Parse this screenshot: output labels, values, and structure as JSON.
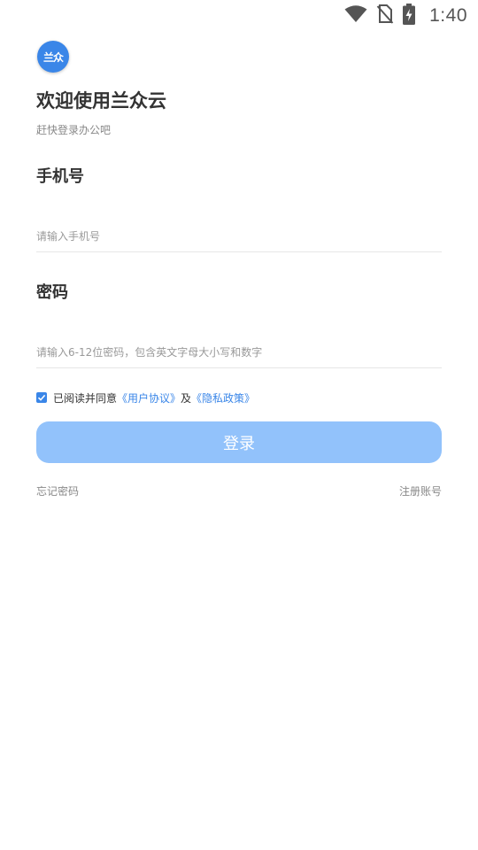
{
  "status_bar": {
    "time": "1:40",
    "icons": [
      "wifi-icon",
      "no-sim-icon",
      "battery-charging-icon"
    ]
  },
  "logo": {
    "text": "兰众"
  },
  "header": {
    "title": "欢迎使用兰众云",
    "subtitle": "赶快登录办公吧"
  },
  "phone": {
    "label": "手机号",
    "placeholder": "请输入手机号",
    "value": ""
  },
  "password": {
    "label": "密码",
    "placeholder": "请输入6-12位密码，包含英文字母大小写和数字",
    "value": ""
  },
  "agreement": {
    "checked": true,
    "prefix": "已阅读并同意",
    "user_agreement": "《用户协议》",
    "and": "及",
    "privacy_policy": "《隐私政策》"
  },
  "login_button": {
    "label": "登录"
  },
  "links": {
    "forgot_password": "忘记密码",
    "register": "注册账号"
  },
  "colors": {
    "accent": "#3a86e8",
    "button_disabled": "#92c2fb"
  }
}
